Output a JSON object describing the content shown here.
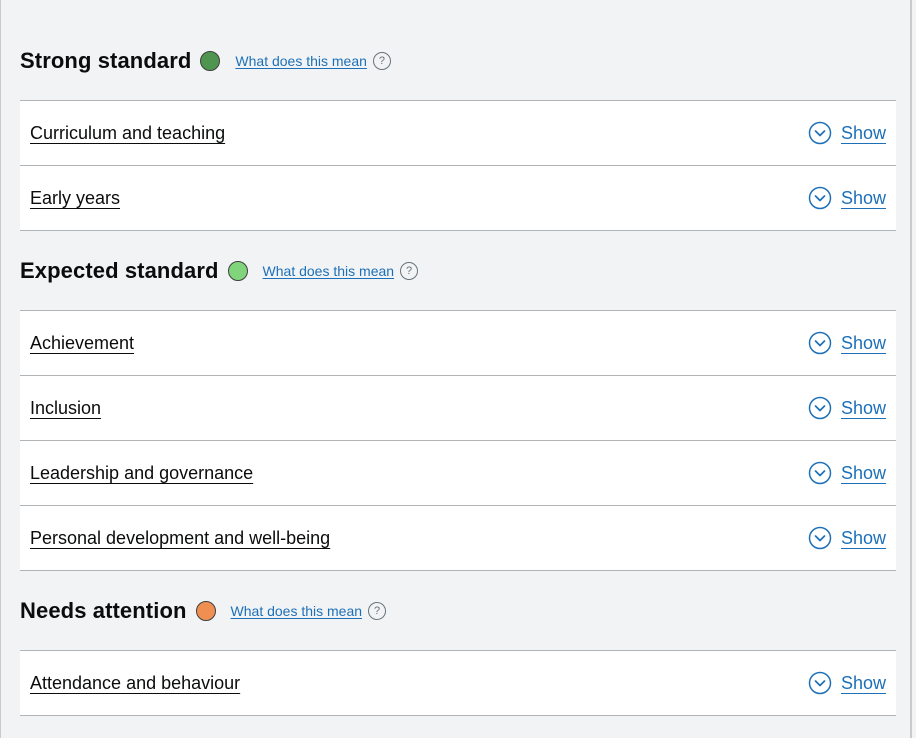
{
  "sections": [
    {
      "heading": "Strong standard",
      "status_color": "#4f944f",
      "help_link": "What does this mean",
      "items": [
        {
          "label": "Curriculum and teaching",
          "action": "Show"
        },
        {
          "label": "Early years",
          "action": "Show"
        }
      ]
    },
    {
      "heading": "Expected standard",
      "status_color": "#7fd47c",
      "help_link": "What does this mean",
      "items": [
        {
          "label": "Achievement",
          "action": "Show"
        },
        {
          "label": "Inclusion",
          "action": "Show"
        },
        {
          "label": "Leadership and governance",
          "action": "Show"
        },
        {
          "label": "Personal development and well-being",
          "action": "Show"
        }
      ]
    },
    {
      "heading": "Needs attention",
      "status_color": "#f08f52",
      "help_link": "What does this mean",
      "items": [
        {
          "label": "Attendance and behaviour",
          "action": "Show"
        }
      ]
    }
  ],
  "icons": {
    "help": "question-circle-icon",
    "expand": "chevron-circle-down-icon"
  }
}
